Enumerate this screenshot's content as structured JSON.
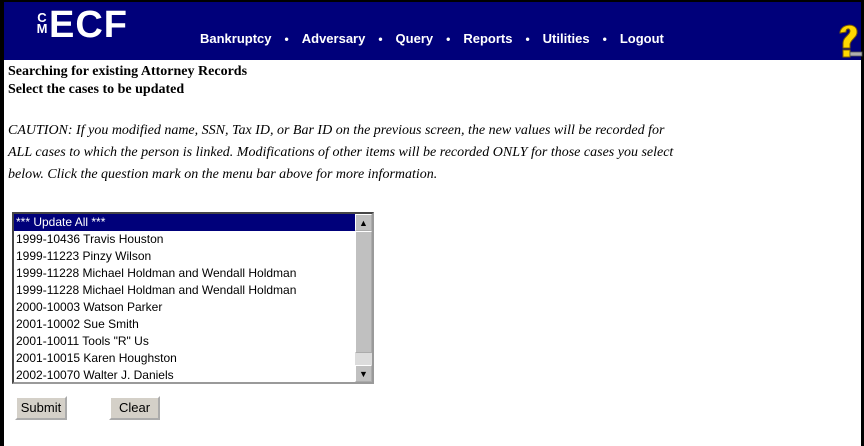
{
  "menubar": {
    "logo_cm": "CM",
    "logo_ecf": "ECF",
    "items": [
      "Bankruptcy",
      "Adversary",
      "Query",
      "Reports",
      "Utilities",
      "Logout"
    ],
    "separator": "•",
    "help_icon": "question-mark-icon",
    "color": "#00007a"
  },
  "headings": {
    "title": "Searching for existing Attorney Records",
    "subtitle": "Select the cases to be updated"
  },
  "caution": {
    "line1": "CAUTION: If you modified name, SSN, Tax ID, or Bar ID on the previous screen, the new values will be recorded for",
    "line2": "ALL cases to which the person is linked. Modifications of other items will be recorded ONLY for those cases you select",
    "line3": "below. Click the question mark on the menu bar above for more information."
  },
  "case_list": {
    "selected_index": 0,
    "options": [
      "*** Update All ***",
      "1999-10436 Travis Houston",
      "1999-11223 Pinzy Wilson",
      "1999-11228 Michael Holdman and Wendall Holdman",
      "1999-11228 Michael Holdman and Wendall Holdman",
      "2000-10003 Watson Parker",
      "2001-10002 Sue Smith",
      "2001-10011 Tools \"R\" Us",
      "2001-10015 Karen Houghston",
      "2002-10070 Walter J. Daniels"
    ]
  },
  "buttons": {
    "submit": "Submit",
    "clear": "Clear"
  }
}
